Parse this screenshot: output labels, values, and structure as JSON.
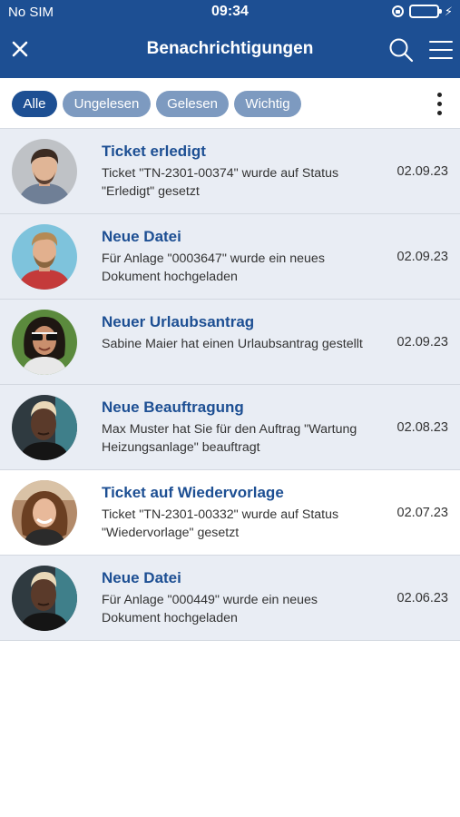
{
  "status_bar": {
    "carrier": "No SIM",
    "time": "09:34",
    "battery_icon": "battery-full-icon",
    "charging_icon": "bolt-icon"
  },
  "nav": {
    "title": "Benachrichtigungen",
    "close_icon": "close-icon",
    "search_icon": "search-icon",
    "menu_icon": "hamburger-menu-icon"
  },
  "colors": {
    "brand": "#1d4f93",
    "chip_inactive": "#7d9ac0",
    "unread_row": "#e9edf4",
    "read_row": "#ffffff",
    "battery": "#4cd964"
  },
  "filters": [
    {
      "label": "Alle",
      "active": true
    },
    {
      "label": "Ungelesen",
      "active": false
    },
    {
      "label": "Gelesen",
      "active": false
    },
    {
      "label": "Wichtig",
      "active": false
    }
  ],
  "more_icon": "more-vertical-icon",
  "notifications": [
    {
      "title": "Ticket erledigt",
      "text": "Ticket \"TN-2301-00374\" wurde auf Status \"Erledigt\" gesetzt",
      "date": "02.09.23",
      "read": false
    },
    {
      "title": "Neue Datei",
      "text": "Für Anlage \"0003647\" wurde ein neues Dokument hochgeladen",
      "date": "02.09.23",
      "read": false
    },
    {
      "title": "Neuer Urlaubsantrag",
      "text": "Sabine Maier hat einen Urlaubsantrag gestellt",
      "date": "02.09.23",
      "read": false
    },
    {
      "title": "Neue Beauftragung",
      "text": "Max Muster hat Sie für den Auftrag \"Wartung Heizungsanlage\" beauftragt",
      "date": "02.08.23",
      "read": false
    },
    {
      "title": "Ticket auf Wiedervorlage",
      "text": "Ticket \"TN-2301-00332\" wurde auf Status \"Wiedervorlage\" gesetzt",
      "date": "02.07.23",
      "read": true
    },
    {
      "title": "Neue Datei",
      "text": "Für Anlage \"000449\" wurde ein neues Dokument hochgeladen",
      "date": "02.06.23",
      "read": false
    }
  ]
}
